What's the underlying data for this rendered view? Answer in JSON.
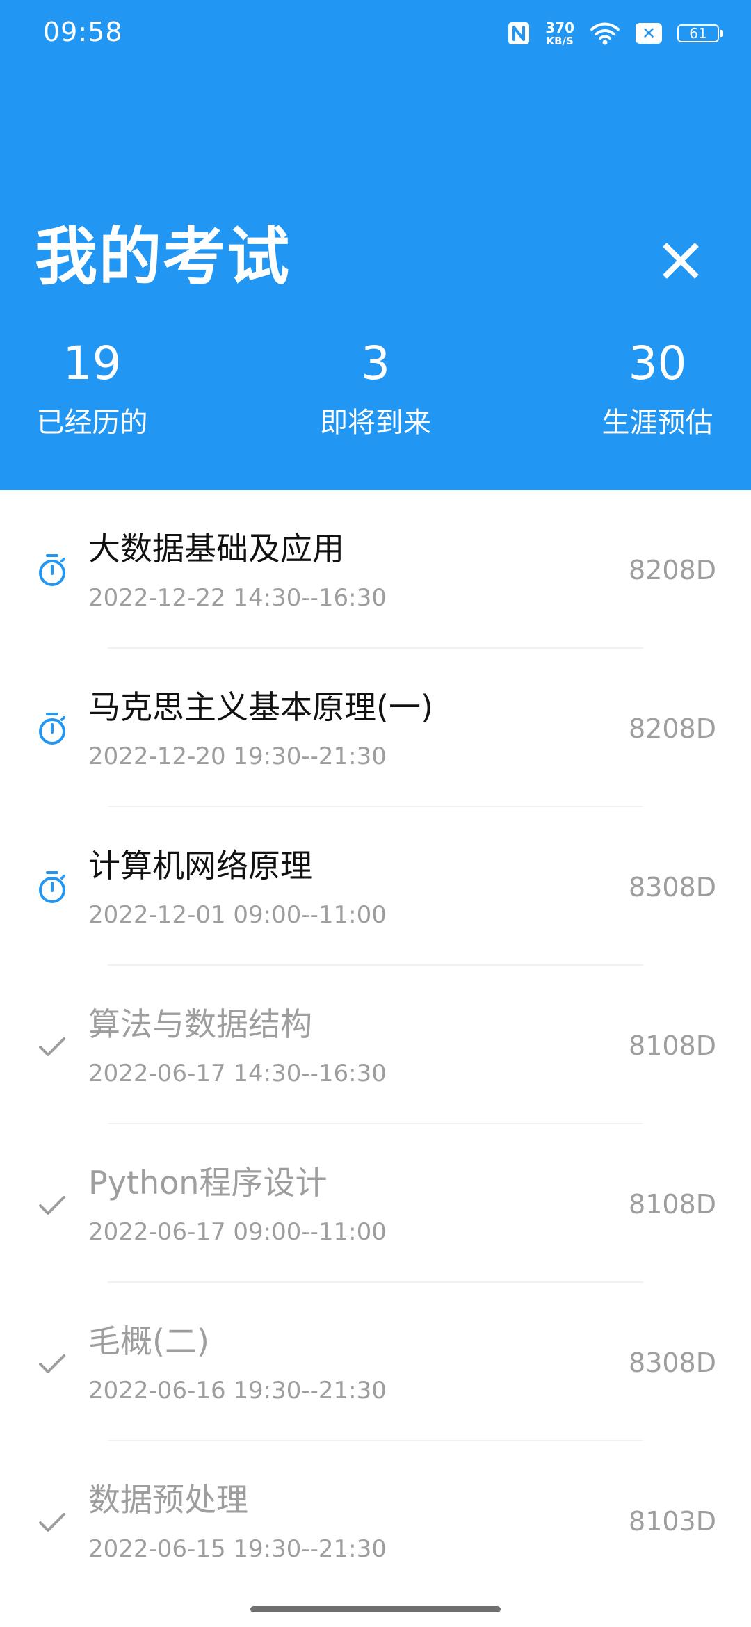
{
  "status_bar": {
    "time": "09:58",
    "network_speed_value": "370",
    "network_speed_unit": "KB/S",
    "battery": "61",
    "icons": [
      "nfc-icon",
      "wifi-icon",
      "no-sim-icon",
      "battery-icon"
    ]
  },
  "header": {
    "title": "我的考试",
    "close_icon": "close-icon",
    "stats": [
      {
        "value": "19",
        "label": "已经历的"
      },
      {
        "value": "3",
        "label": "即将到来"
      },
      {
        "value": "30",
        "label": "生涯预估"
      }
    ]
  },
  "exams": [
    {
      "title": "大数据基础及应用",
      "time": "2022-12-22 14:30--16:30",
      "room": "8208D",
      "status": "upcoming",
      "icon": "stopwatch-icon"
    },
    {
      "title": "马克思主义基本原理(一)",
      "time": "2022-12-20 19:30--21:30",
      "room": "8208D",
      "status": "upcoming",
      "icon": "stopwatch-icon"
    },
    {
      "title": "计算机网络原理",
      "time": "2022-12-01 09:00--11:00",
      "room": "8308D",
      "status": "upcoming",
      "icon": "stopwatch-icon"
    },
    {
      "title": "算法与数据结构",
      "time": "2022-06-17 14:30--16:30",
      "room": "8108D",
      "status": "done",
      "icon": "check-icon"
    },
    {
      "title": "Python程序设计",
      "time": "2022-06-17 09:00--11:00",
      "room": "8108D",
      "status": "done",
      "icon": "check-icon"
    },
    {
      "title": "毛概(二)",
      "time": "2022-06-16 19:30--21:30",
      "room": "8308D",
      "status": "done",
      "icon": "check-icon"
    },
    {
      "title": "数据预处理",
      "time": "2022-06-15 19:30--21:30",
      "room": "8103D",
      "status": "done",
      "icon": "check-icon"
    }
  ],
  "colors": {
    "accent": "#2196F3",
    "upcoming_title": "#111111",
    "muted": "#9e9e9e"
  }
}
